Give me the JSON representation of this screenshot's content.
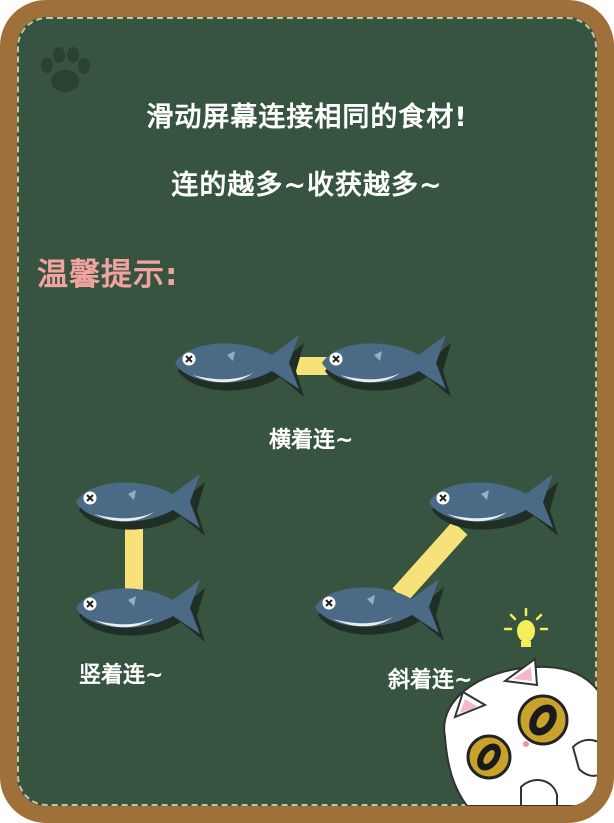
{
  "instructions": {
    "line1": "滑动屏幕连接相同的食材!",
    "line2": "连的越多~收获越多~"
  },
  "tips": {
    "title": "温馨提示:",
    "examples": [
      {
        "id": "horizontal",
        "label": "横着连~"
      },
      {
        "id": "vertical",
        "label": "竖着连~"
      },
      {
        "id": "diagonal",
        "label": "斜着连~"
      }
    ]
  },
  "colors": {
    "board": "#36543f",
    "frame": "#a0703b",
    "fish_body": "#4a6a86",
    "connector": "#f7e27a",
    "tips_title": "#f2a3a0"
  },
  "icons": [
    "paw-icon",
    "fish-icon",
    "lightbulb-icon",
    "cat-mascot"
  ]
}
